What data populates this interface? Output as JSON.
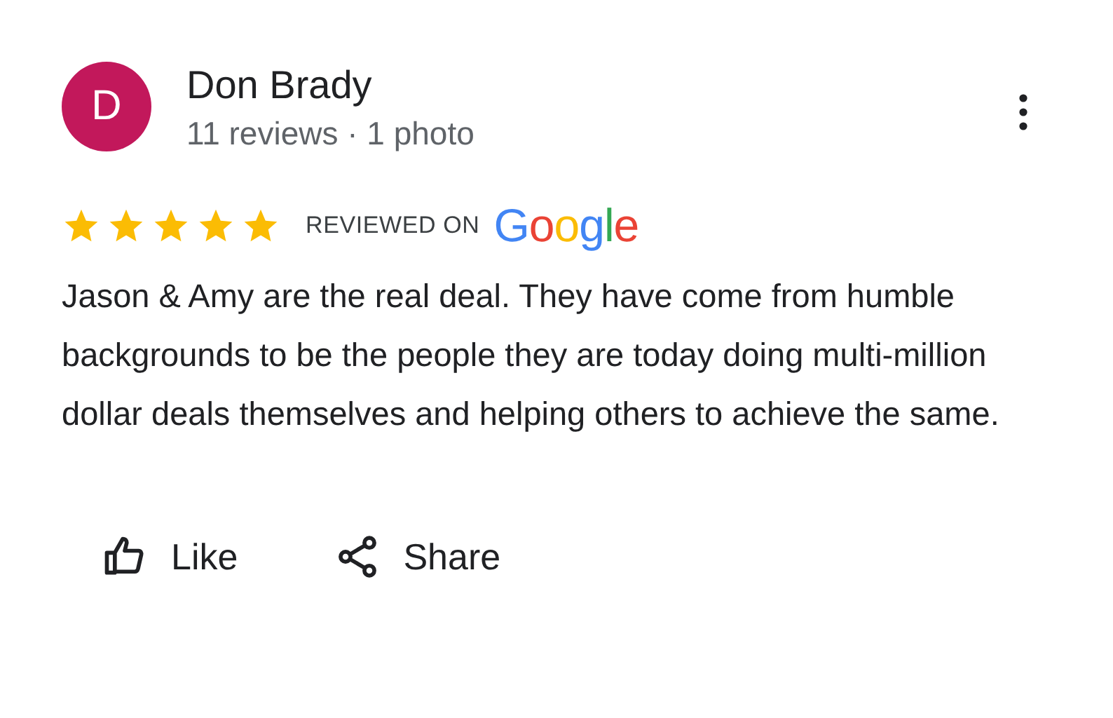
{
  "review": {
    "avatar_letter": "D",
    "author": "Don Brady",
    "meta": "11 reviews · 1 photo",
    "stars": 5,
    "reviewed_on": "REVIEWED ON",
    "source": "Google",
    "text": "Jason & Amy are the real deal. They have come from humble backgrounds to be the people they are today doing multi-million dollar deals themselves and helping others to achieve the same."
  },
  "actions": [
    {
      "kind": "like",
      "label": "Like"
    },
    {
      "kind": "share",
      "label": "Share"
    }
  ]
}
